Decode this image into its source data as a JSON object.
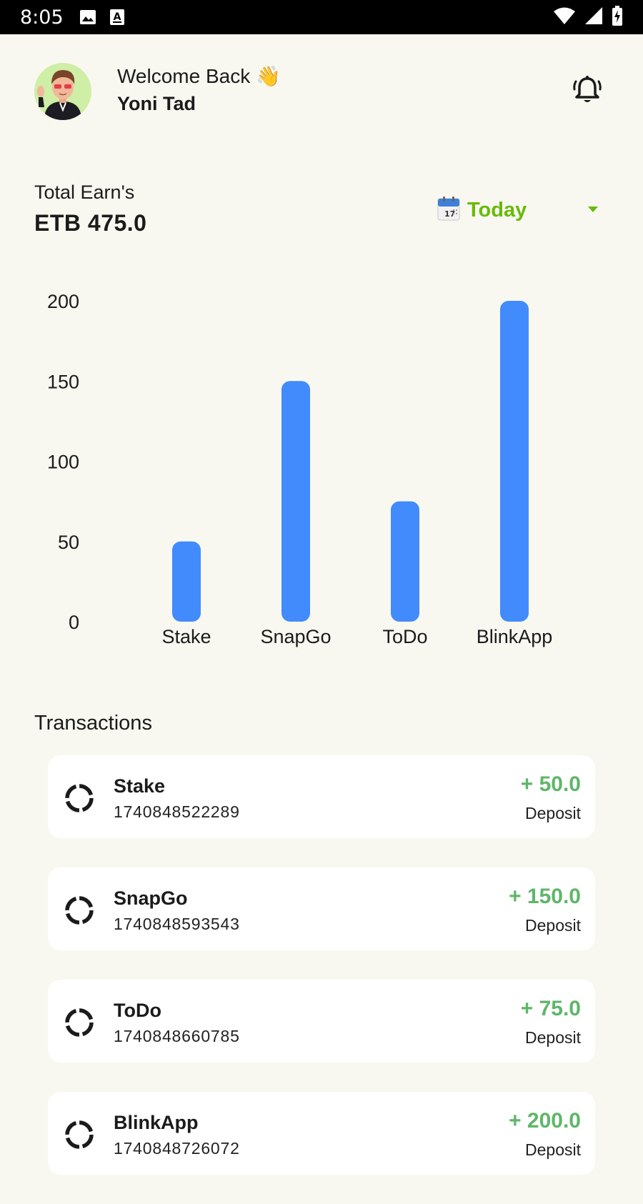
{
  "status_bar": {
    "time": "8:05",
    "icons": [
      "image-icon",
      "font-download-icon",
      "wifi-icon",
      "signal-icon",
      "battery-charging-icon"
    ]
  },
  "header": {
    "welcome": "Welcome Back",
    "wave_emoji": "👋",
    "username": "Yoni Tad",
    "avatar_icon": "avatar-3d-character",
    "notification_icon": "bell-icon"
  },
  "earnings": {
    "label": "Total Earn's",
    "value": "ETB 475.0",
    "period": "Today",
    "period_icon": "calendar-icon"
  },
  "colors": {
    "background": "#f8f8f1",
    "bar": "#418bfd",
    "accent_green": "#6ab90a",
    "amount_green": "#5fb66a"
  },
  "chart_data": {
    "type": "bar",
    "categories": [
      "Stake",
      "SnapGo",
      "ToDo",
      "BlinkApp"
    ],
    "values": [
      50,
      150,
      75,
      200
    ],
    "ylim": [
      0,
      200
    ],
    "yticks": [
      0,
      50,
      100,
      150,
      200
    ],
    "grid": false,
    "bar_color": "#418bfd"
  },
  "transactions": {
    "title": "Transactions",
    "items": [
      {
        "name": "Stake",
        "id": "1740848522289",
        "amount": "+ 50.0",
        "type": "Deposit"
      },
      {
        "name": "SnapGo",
        "id": "1740848593543",
        "amount": "+ 150.0",
        "type": "Deposit"
      },
      {
        "name": "ToDo",
        "id": "1740848660785",
        "amount": "+ 75.0",
        "type": "Deposit"
      },
      {
        "name": "BlinkApp",
        "id": "1740848726072",
        "amount": "+ 200.0",
        "type": "Deposit"
      }
    ]
  }
}
